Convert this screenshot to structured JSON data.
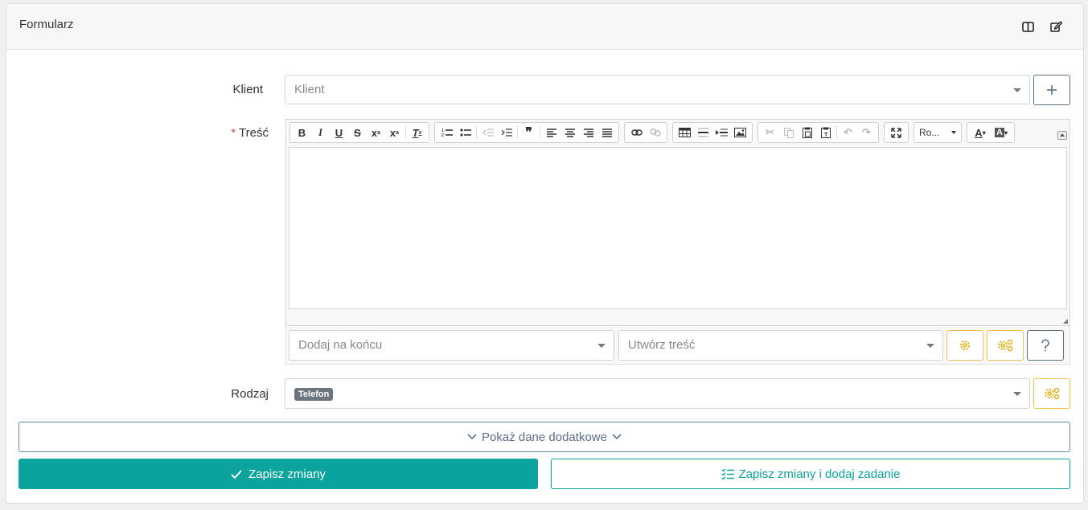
{
  "panel": {
    "title": "Formularz"
  },
  "form": {
    "client": {
      "label": "Klient",
      "placeholder": "Klient"
    },
    "content": {
      "label": "Treść",
      "required_mark": "*"
    },
    "kind": {
      "label": "Rodzaj",
      "selected_tag": "Telefon"
    }
  },
  "editor": {
    "font_select": "Ro...",
    "toolbar_groups": [
      [
        "bold",
        "italic",
        "underline",
        "strikethrough",
        "subscript",
        "superscript",
        "remove-format"
      ],
      [
        "numbered-list",
        "bulleted-list",
        "outdent",
        "indent",
        "blockquote",
        "align-left",
        "align-center",
        "align-right",
        "justify"
      ],
      [
        "link",
        "unlink"
      ],
      [
        "table",
        "horizontal-line",
        "page-break",
        "image"
      ],
      [
        "cut",
        "copy",
        "paste",
        "paste-text",
        "undo",
        "redo"
      ],
      [
        "maximize"
      ]
    ]
  },
  "tools": {
    "append_placeholder": "Dodaj na końcu",
    "create_placeholder": "Utwórz treść"
  },
  "buttons": {
    "show_more": "Pokaż dane dodatkowe",
    "save": "Zapisz zmiany",
    "save_and_task": "Zapisz zmiany i dodaj zadanie"
  },
  "colors": {
    "accent": "#0aa39e",
    "warning": "#f0c24b",
    "secondary": "#5b6f86"
  }
}
